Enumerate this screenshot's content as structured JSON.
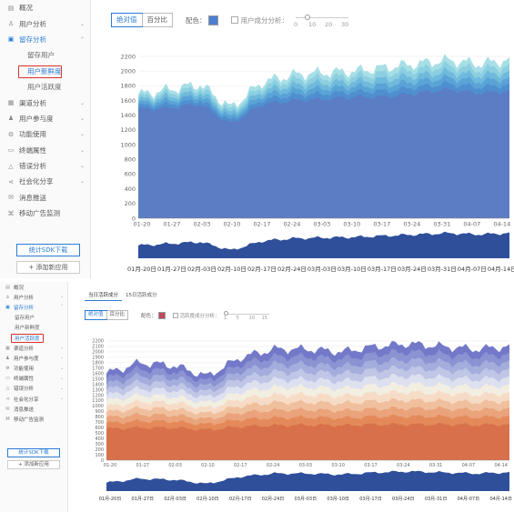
{
  "top": {
    "sidebar": {
      "items": [
        {
          "label": "概况",
          "icon": "bar-chart-icon"
        },
        {
          "label": "用户分析",
          "icon": "user-icon"
        },
        {
          "label": "留存分析",
          "icon": "retention-icon",
          "active": true
        },
        {
          "label": "留存用户",
          "sub": true
        },
        {
          "label": "用户新鲜度",
          "sub": true,
          "selected": true
        },
        {
          "label": "用户活跃度",
          "sub": true
        },
        {
          "label": "渠道分析",
          "icon": "channel-icon"
        },
        {
          "label": "用户参与度",
          "icon": "participation-icon"
        },
        {
          "label": "功能使用",
          "icon": "function-icon"
        },
        {
          "label": "终端属性",
          "icon": "terminal-icon"
        },
        {
          "label": "错误分析",
          "icon": "warning-icon"
        },
        {
          "label": "社会化分享",
          "icon": "share-icon"
        },
        {
          "label": "消息推送",
          "icon": "push-icon"
        },
        {
          "label": "移动广告监测",
          "icon": "ad-monitor-icon"
        }
      ],
      "sdk_button": "统计SDK下载",
      "add_button": "+ 添加新应用"
    },
    "toolbar": {
      "seg_absolute": "绝对值",
      "seg_percent": "百分比",
      "color_label": "配色：",
      "checkbox_label": "用户成分分析：",
      "slider_ticks": [
        "0",
        "10",
        "20",
        "30"
      ]
    },
    "colors": {
      "swatch": "#4d7fd0",
      "accent": "#2b7bd6",
      "highlight": "#d8322c"
    },
    "chart_data": {
      "type": "area",
      "stacked": true,
      "x": [
        "01-20",
        "01-27",
        "02-03",
        "02-10",
        "02-17",
        "02-24",
        "03-03",
        "03-10",
        "03-17",
        "03-24",
        "03-31",
        "04-07",
        "04-14"
      ],
      "yticks": [
        0,
        200,
        400,
        600,
        800,
        1000,
        1200,
        1400,
        1600,
        1800,
        2000,
        2200
      ],
      "ylim": [
        0,
        2250
      ],
      "total_approx": [
        1680,
        1750,
        1820,
        1500,
        1850,
        1950,
        1980,
        2000,
        2050,
        2100,
        2150,
        2100,
        2150
      ],
      "base_approx": [
        1480,
        1500,
        1550,
        1280,
        1550,
        1600,
        1620,
        1650,
        1650,
        1700,
        1750,
        1700,
        1730
      ],
      "layer_colors": [
        "#5b7dc4",
        "#4f8fcf",
        "#5aa3d6",
        "#6fbadc",
        "#8ccfe0",
        "#a8dfe6"
      ],
      "brush_labels": [
        "01月-20日",
        "01月-27日",
        "02月-03日",
        "02月-10日",
        "02月-17日",
        "02月-24日",
        "03月-03日",
        "03月-10日",
        "03月-17日",
        "03月-24日",
        "03月-31日",
        "04月-07日",
        "04月-14日"
      ]
    }
  },
  "bottom": {
    "tabs": [
      "当日活跃成分",
      "15日活跃成分"
    ],
    "sidebar": {
      "items": [
        {
          "label": "概况",
          "icon": "bar-chart-icon"
        },
        {
          "label": "用户分析",
          "icon": "user-icon"
        },
        {
          "label": "留存分析",
          "icon": "retention-icon",
          "active": true
        },
        {
          "label": "留存用户",
          "sub": true
        },
        {
          "label": "用户新鲜度",
          "sub": true
        },
        {
          "label": "用户活跃度",
          "sub": true,
          "selected": true
        },
        {
          "label": "渠道分析",
          "icon": "channel-icon"
        },
        {
          "label": "用户参与度",
          "icon": "participation-icon"
        },
        {
          "label": "功能使用",
          "icon": "function-icon"
        },
        {
          "label": "终端属性",
          "icon": "terminal-icon"
        },
        {
          "label": "错误分析",
          "icon": "warning-icon"
        },
        {
          "label": "社会化分享",
          "icon": "share-icon"
        },
        {
          "label": "消息推送",
          "icon": "push-icon"
        },
        {
          "label": "移动广告监测",
          "icon": "ad-monitor-icon"
        }
      ],
      "sdk_button": "统计SDK下载",
      "add_button": "+ 添加新应用"
    },
    "toolbar": {
      "seg_absolute": "绝对值",
      "seg_percent": "百分比",
      "color_label": "配色：",
      "checkbox_label": "活跃度成分分析：",
      "slider_ticks": [
        "1",
        "5",
        "10",
        "15"
      ]
    },
    "colors": {
      "swatch": "#c04a5a"
    },
    "chart_data": {
      "type": "area",
      "stacked": true,
      "x": [
        "01-20",
        "01-27",
        "02-03",
        "02-10",
        "02-17",
        "02-24",
        "03-03",
        "03-10",
        "03-17",
        "03-24",
        "03-31",
        "04-07",
        "04-14"
      ],
      "yticks": [
        0,
        100,
        200,
        300,
        400,
        500,
        600,
        700,
        800,
        900,
        1000,
        1100,
        1200,
        1300,
        1400,
        1500,
        1600,
        1700,
        1800,
        1900,
        2000,
        2100,
        2200
      ],
      "ylim": [
        0,
        2250
      ],
      "total_approx": [
        1600,
        1800,
        1750,
        1550,
        1900,
        2050,
        2050,
        2000,
        2100,
        2150,
        2100,
        2050,
        2100
      ],
      "base_approx": [
        580,
        600,
        600,
        560,
        620,
        640,
        650,
        640,
        660,
        660,
        660,
        650,
        660
      ],
      "layer_colors": [
        "#d8714b",
        "#e48a5a",
        "#eaa37a",
        "#f0c09e",
        "#f6dcc6",
        "#f3eee2",
        "#dde0ef",
        "#c0c6e6",
        "#a5addd",
        "#8b93d2",
        "#7379c8"
      ],
      "brush_labels": [
        "01月-20日",
        "01月-27日",
        "02月-03日",
        "02月-10日",
        "02月-17日",
        "02月-24日",
        "03月-03日",
        "03月-10日",
        "03月-17日",
        "03月-24日",
        "03月-31日",
        "04月-07日",
        "04月-14日"
      ]
    }
  }
}
